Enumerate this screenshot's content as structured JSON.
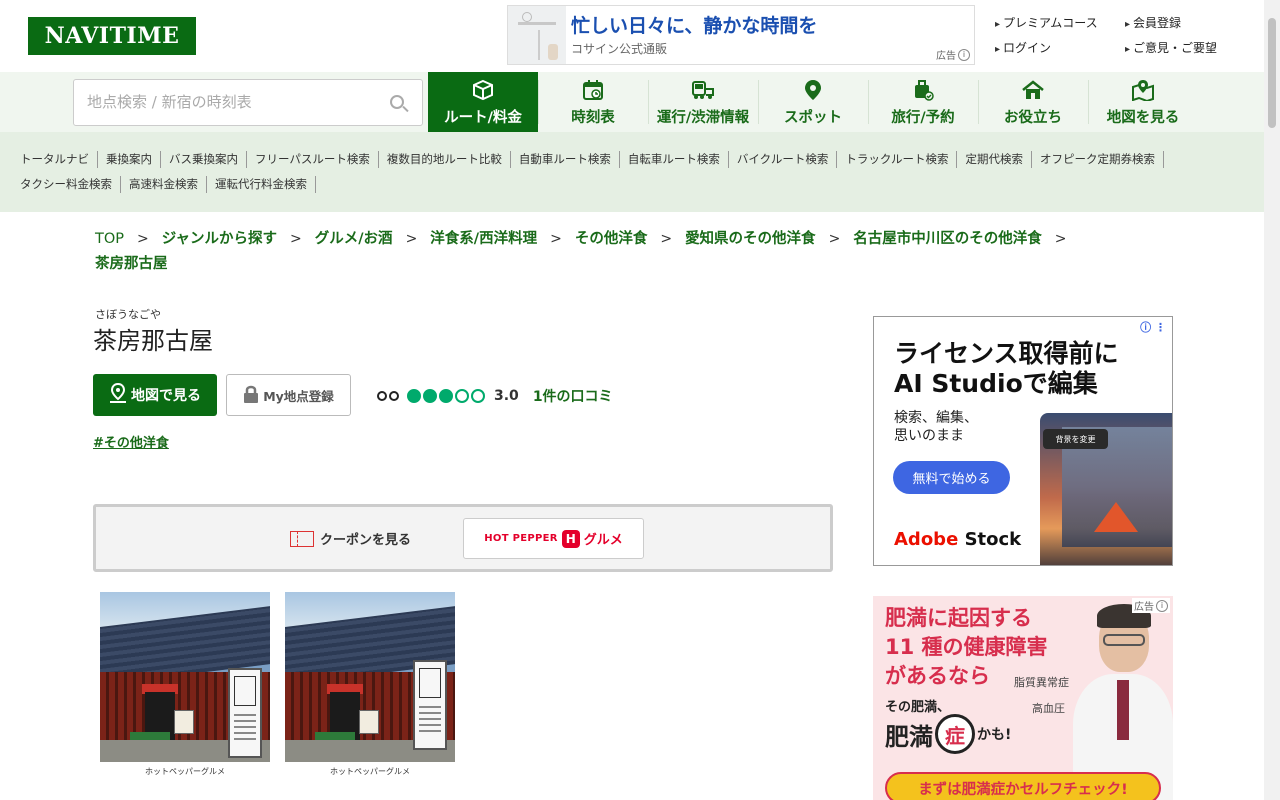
{
  "header": {
    "logo": "NAVITIME",
    "ad": {
      "headline": "忙しい日々に、静かな時間を",
      "sub": "コサイン公式通販",
      "label": "広告"
    },
    "links": [
      "プレミアムコース",
      "会員登録",
      "ログイン",
      "ご意見・ご要望"
    ]
  },
  "nav": {
    "search_placeholder": "地点検索 / 新宿の時刻表",
    "tabs": [
      {
        "label": "ルート/料金",
        "icon": "route-box-icon",
        "active": true
      },
      {
        "label": "時刻表",
        "icon": "timetable-icon"
      },
      {
        "label": "運行/渋滞情報",
        "icon": "traffic-icon"
      },
      {
        "label": "スポット",
        "icon": "map-pin-icon"
      },
      {
        "label": "旅行/予約",
        "icon": "suitcase-icon"
      },
      {
        "label": "お役立ち",
        "icon": "house-icon"
      },
      {
        "label": "地図を見る",
        "icon": "map-icon"
      }
    ]
  },
  "subnav": [
    "トータルナビ",
    "乗換案内",
    "バス乗換案内",
    "フリーパスルート検索",
    "複数目的地ルート比較",
    "自動車ルート検索",
    "自転車ルート検索",
    "バイクルート検索",
    "トラックルート検索",
    "定期代検索",
    "オフピーク定期券検索",
    "タクシー料金検索",
    "高速料金検索",
    "運転代行料金検索"
  ],
  "breadcrumb": [
    "TOP",
    "ジャンルから探す",
    "グルメ/お酒",
    "洋食系/西洋料理",
    "その他洋食",
    "愛知県のその他洋食",
    "名古屋市中川区のその他洋食",
    "茶房那古屋"
  ],
  "spot": {
    "furigana": "さぼうなごや",
    "name": "茶房那古屋",
    "map_button": "地図で見る",
    "my_button": "My地点登録",
    "rating": 3.0,
    "rating_text": "3.0",
    "reviews": "1件の口コミ",
    "tag": "#その他洋食"
  },
  "coupon": {
    "link": "クーポンを見る",
    "hp_text": "HOT PEPPER",
    "hp_h": "H",
    "hp_gurume": "グルメ"
  },
  "photos": [
    {
      "caption": "ホットペッパーグルメ"
    },
    {
      "caption": "ホットペッパーグルメ"
    }
  ],
  "ads": {
    "adobe": {
      "line1": "ライセンス取得前に",
      "line2": "AI Studioで編集",
      "sub1": "検索、編集、",
      "sub2": "思いのまま",
      "chip": "背景を変更",
      "cta": "無料で始める",
      "brand_a": "Adobe",
      "brand_b": "Stock"
    },
    "health": {
      "label": "広告",
      "line1": "肥満に起因する",
      "line2": "11 種の健康障害",
      "line3": "があるなら",
      "side1": "脂質異常症",
      "side2": "高血圧",
      "pre": "その肥満、",
      "big1": "肥満",
      "mag": "症",
      "kamo": "かも!",
      "cta": "まずは肥満症かセルフチェック!"
    }
  },
  "colors": {
    "brand_green": "#0a6b13",
    "link_green": "#1a6b1a",
    "rating_green": "#00aa6c",
    "hotpepper_red": "#e4002b"
  }
}
